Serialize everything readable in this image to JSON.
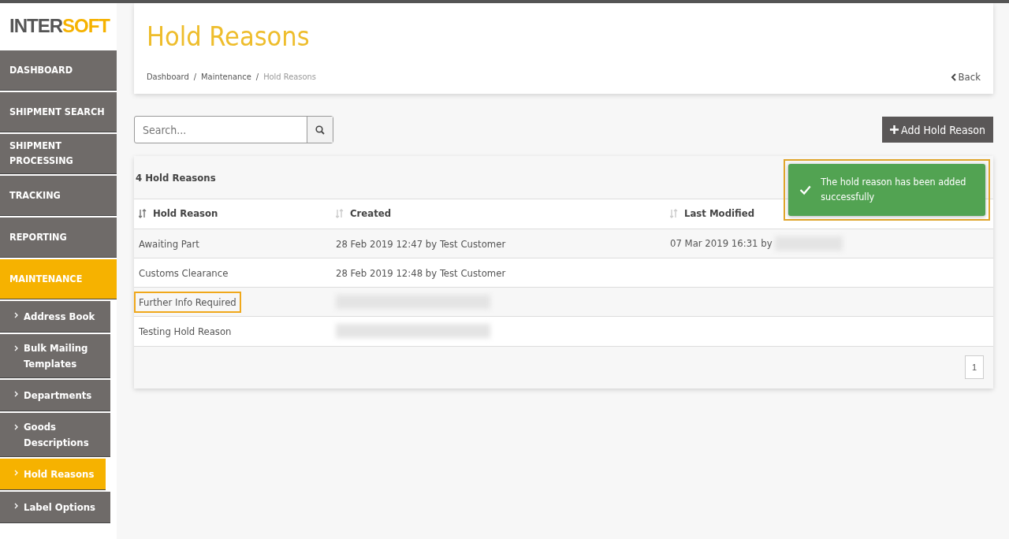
{
  "logo": {
    "dark": "INTER",
    "accent": "SOFT"
  },
  "sidebar": {
    "items": [
      {
        "label": "DASHBOARD",
        "kind": "main",
        "selected": false
      },
      {
        "label": "SHIPMENT SEARCH",
        "kind": "main",
        "selected": false
      },
      {
        "label": "SHIPMENT PROCESSING",
        "kind": "main",
        "selected": false
      },
      {
        "label": "TRACKING",
        "kind": "main",
        "selected": false
      },
      {
        "label": "REPORTING",
        "kind": "main",
        "selected": false
      },
      {
        "label": "MAINTENANCE",
        "kind": "main",
        "selected": true
      },
      {
        "label": "Address Book",
        "kind": "sub",
        "selected": false
      },
      {
        "label": "Bulk Mailing Templates",
        "kind": "sub",
        "selected": false
      },
      {
        "label": "Departments",
        "kind": "sub",
        "selected": false
      },
      {
        "label": "Goods Descriptions",
        "kind": "sub",
        "selected": false
      },
      {
        "label": "Hold Reasons",
        "kind": "sub",
        "selected": true
      },
      {
        "label": "Label Options",
        "kind": "sub",
        "selected": false
      }
    ]
  },
  "header": {
    "title": "Hold Reasons",
    "separator": "/",
    "breadcrumbs": [
      "Dashboard",
      "Maintenance",
      "Hold Reasons"
    ],
    "back": "Back"
  },
  "search": {
    "placeholder": "Search..."
  },
  "add_button": "Add Hold Reason",
  "count": "4 Hold Reasons",
  "toast": {
    "message": "The hold reason has been added successfully",
    "highlighted": true
  },
  "table": {
    "columns": [
      "Hold Reason",
      "Created",
      "Last Modified"
    ],
    "rows": [
      {
        "cells": [
          "Awaiting Part",
          "28 Feb 2019 12:47 by Test Customer",
          "07 Mar 2019 16:31 by"
        ],
        "redacted": [
          false,
          false,
          true
        ],
        "highlighted": false
      },
      {
        "cells": [
          "Customs Clearance",
          "28 Feb 2019 12:48 by Test Customer",
          ""
        ],
        "redacted": [
          false,
          false,
          false
        ],
        "highlighted": false
      },
      {
        "cells": [
          "Further Info Required",
          "",
          ""
        ],
        "redacted": [
          false,
          true,
          false
        ],
        "highlighted": true
      },
      {
        "cells": [
          "Testing Hold Reason",
          "",
          ""
        ],
        "redacted": [
          false,
          true,
          false
        ],
        "highlighted": false
      }
    ]
  },
  "pagination": {
    "pages": [
      {
        "label": "1",
        "selected": true
      }
    ]
  }
}
